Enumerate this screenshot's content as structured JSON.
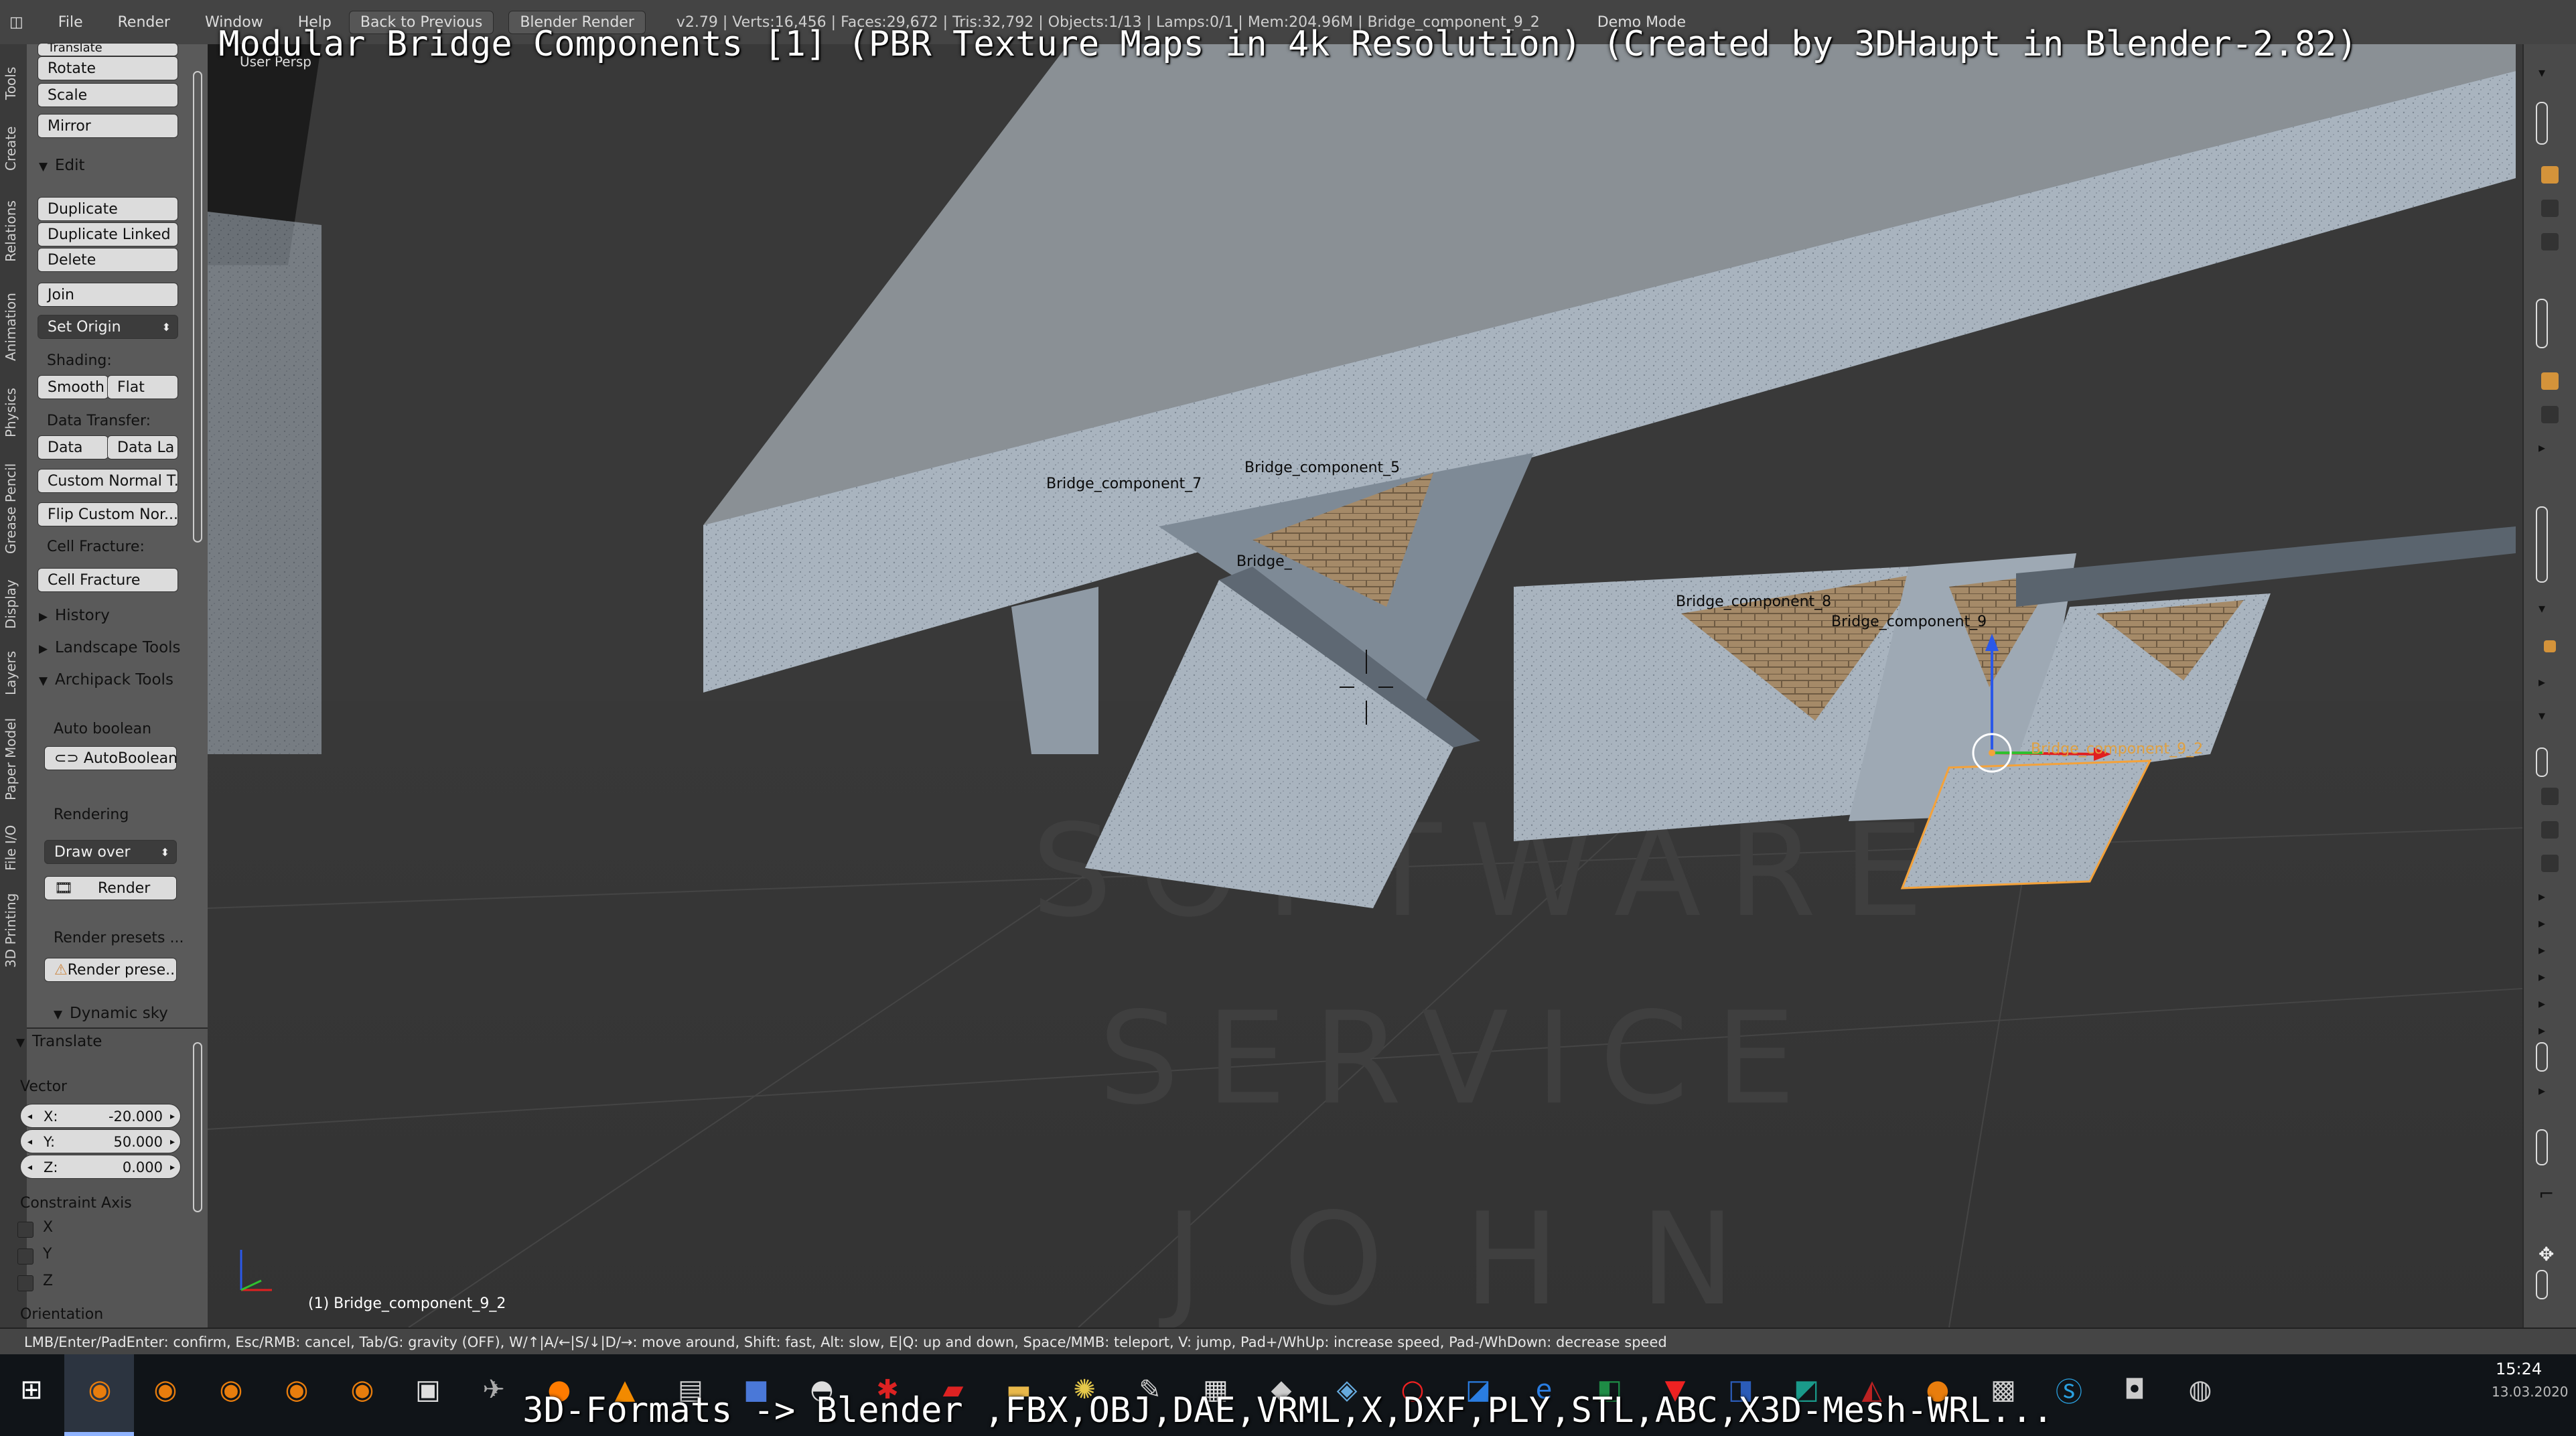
{
  "overlay": {
    "title": "Modular Bridge Components [1] (PBR Texture Maps in 4k Resolution) (Created by 3DHaupt in Blender-2.82)",
    "subtitle": "3D-Formats -> Blender ,FBX,OBJ,DAE,VRML,X,DXF,PLY,STL,ABC,X3D-Mesh-WRL..."
  },
  "header": {
    "menus": [
      "File",
      "Render",
      "Window",
      "Help"
    ],
    "back_button": "Back to Previous",
    "render_engine": "Blender Render",
    "stats": "v2.79 | Verts:16,456 | Faces:29,672 | Tris:32,792 | Objects:1/13 | Lamps:0/1 | Mem:204.96M | Bridge_component_9_2",
    "mode": "Demo Mode"
  },
  "tabs": [
    "Tools",
    "Create",
    "Relations",
    "Animation",
    "Physics",
    "Grease Pencil",
    "Display",
    "Layers",
    "Paper Model",
    "File I/O",
    "3D Printing"
  ],
  "toolshelf": {
    "top_cut": "Translate",
    "rotate": "Rotate",
    "scale": "Scale",
    "mirror": "Mirror",
    "edit_header": "Edit",
    "duplicate": "Duplicate",
    "duplicate_linked": "Duplicate Linked",
    "delete": "Delete",
    "join": "Join",
    "set_origin": "Set Origin",
    "shading_label": "Shading:",
    "smooth": "Smooth",
    "flat": "Flat",
    "data_transfer_label": "Data Transfer:",
    "data": "Data",
    "data_layout": "Data La",
    "custom_normal": "Custom Normal T...",
    "flip_custom": "Flip Custom Nor...",
    "cell_fracture_label": "Cell Fracture:",
    "cell_fracture": "Cell Fracture",
    "history": "History",
    "landscape_tools": "Landscape Tools",
    "archipack_tools": "Archipack Tools",
    "auto_boolean_label": "Auto boolean",
    "auto_boolean": "AutoBoolean",
    "rendering_label": "Rendering",
    "draw_over": "Draw over",
    "render": "Render",
    "render_presets_label": "Render presets ...",
    "render_presets": "Render prese...",
    "dynamic_sky": "Dynamic sky",
    "operator_header": "Translate",
    "vector_label": "Vector",
    "vector": [
      {
        "axis": "X:",
        "value": "-20.000"
      },
      {
        "axis": "Y:",
        "value": "50.000"
      },
      {
        "axis": "Z:",
        "value": "0.000"
      }
    ],
    "constraint_label": "Constraint Axis",
    "constraints": [
      "X",
      "Y",
      "Z"
    ],
    "orientation_label": "Orientation"
  },
  "viewport": {
    "view_name": "User Persp",
    "active_object": "(1) Bridge_component_9_2",
    "object_labels": [
      {
        "text": "Bridge_component_7"
      },
      {
        "text": "Bridge_component_5"
      },
      {
        "text": "Bridge_"
      },
      {
        "text": "Bridge_component_8"
      },
      {
        "text": "Bridge_component_9"
      },
      {
        "text": "Bridge_component_9_2"
      }
    ],
    "watermark": [
      "SOFTWARE",
      "SERVICE",
      "JOHN"
    ]
  },
  "statusbar": {
    "text": "LMB/Enter/PadEnter: confirm, Esc/RMB: cancel, Tab/G: gravity (OFF), W/↑|A/←|S/↓|D/→: move around, Shift: fast, Alt: slow, E|Q: up and down, Space/MMB: teleport, V: jump, Pad+/WhUp: increase speed, Pad-/WhDown: decrease speed"
  },
  "taskbar": {
    "time": "15:24",
    "date": "13.03.2020",
    "icons": [
      "windows-start",
      "blender",
      "blender",
      "blender",
      "blender",
      "blender",
      "app",
      "app",
      "firefox",
      "vlc",
      "terminal",
      "save",
      "app",
      "app",
      "acrobat",
      "folder",
      "app",
      "app",
      "app",
      "app",
      "app",
      "app",
      "opera",
      "outlook",
      "edge",
      "excel",
      "app",
      "word",
      "publisher",
      "access",
      "app",
      "app",
      "skype",
      "app",
      "app"
    ]
  },
  "colors": {
    "viewport_bg": "#393939",
    "concrete": "#a9b4bf",
    "brick": "#a58a68",
    "panel_bg": "#5a5a5a",
    "selection_outline": "#f4a23a"
  }
}
